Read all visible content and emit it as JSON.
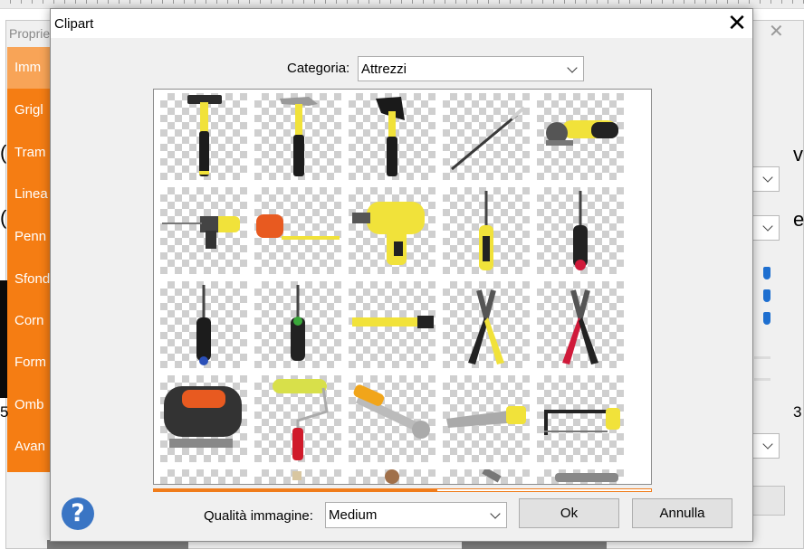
{
  "background_app": {
    "panel_title": "Proprie",
    "sidebar_items": [
      "Imm",
      "Grigl",
      "Tram",
      "Linea",
      "Penn",
      "Sfond",
      "Corn",
      "Form",
      "Omb",
      "Avan"
    ],
    "left_glyphs": [
      "(",
      "(",
      "5"
    ],
    "right_glyphs": [
      "v",
      "e",
      "3"
    ],
    "sidebar_color": "#f57d13"
  },
  "dialog": {
    "title": "Clipart",
    "category_label": "Categoria:",
    "category_value": "Attrezzi",
    "quality_label": "Qualità immagine:",
    "quality_value": "Medium",
    "ok_label": "Ok",
    "cancel_label": "Annulla",
    "help_glyph": "?",
    "load_progress": 0.57,
    "accent_color": "#f07c1a",
    "help_color": "#3a75c4"
  },
  "clipart_items": [
    "claw-hammer",
    "hammer",
    "axe",
    "long-screwdriver",
    "angle-grinder",
    "hammer-drill",
    "tape-measure",
    "power-drill",
    "screwdriver-yellow",
    "screwdriver-red",
    "screwdriver-blue",
    "screwdriver-green",
    "folding-ruler",
    "pliers-yellow",
    "pliers-red",
    "jigsaw",
    "paint-roller",
    "adjustable-wrench",
    "hand-saw",
    "hacksaw",
    "clipart-partial-1",
    "clipart-partial-2",
    "clipart-partial-3",
    "clipart-partial-4",
    "clipart-partial-5"
  ],
  "icons": {
    "close": "close-icon",
    "help": "question-icon",
    "dropdown": "chevron-down-icon",
    "scroll_up": "chevron-up-icon",
    "scroll_down": "chevron-down-icon"
  }
}
